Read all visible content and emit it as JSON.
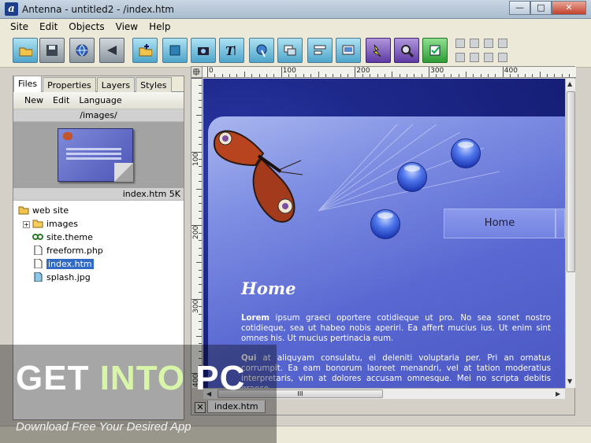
{
  "window": {
    "title": "Antenna - untitled2 - /index.htm",
    "app_icon": "a",
    "min": "—",
    "max": "□",
    "close": "✕"
  },
  "menu": [
    "Site",
    "Edit",
    "Objects",
    "View",
    "Help"
  ],
  "toolbar": {
    "buttons": [
      {
        "name": "open-folder-icon",
        "style": "blue"
      },
      {
        "name": "save-icon",
        "style": "gray"
      },
      {
        "name": "globe-icon",
        "style": "gray"
      },
      {
        "name": "preview-icon",
        "style": "gray"
      },
      {
        "name": "insert-folder-icon",
        "style": "blue"
      },
      {
        "name": "box-icon",
        "style": "blue"
      },
      {
        "name": "camera-icon",
        "style": "blue"
      },
      {
        "name": "text-icon",
        "style": "blue"
      },
      {
        "name": "pointer-icon",
        "style": "blue"
      },
      {
        "name": "images-icon",
        "style": "blue"
      },
      {
        "name": "form-icon",
        "style": "blue"
      },
      {
        "name": "media-icon",
        "style": "blue"
      },
      {
        "name": "effect-icon",
        "style": "purple"
      },
      {
        "name": "zoom-icon",
        "style": "purple"
      },
      {
        "name": "checkbox-icon",
        "style": "green"
      }
    ]
  },
  "left_panel": {
    "tabs": [
      "Files",
      "Properties",
      "Layers",
      "Styles"
    ],
    "active_tab": "Files",
    "subtoolbar": [
      "New",
      "Edit",
      "Language"
    ],
    "path": "/images/",
    "preview_label": "index.htm 5K",
    "tree": [
      {
        "label": "web site",
        "icon": "folder-open-icon",
        "level": 0
      },
      {
        "label": "images",
        "icon": "folder-icon",
        "level": 1,
        "expander": "+"
      },
      {
        "label": "site.theme",
        "icon": "theme-icon",
        "level": 1
      },
      {
        "label": "freeform.php",
        "icon": "file-icon",
        "level": 1
      },
      {
        "label": "index.htm",
        "icon": "file-icon",
        "level": 1,
        "selected": true
      },
      {
        "label": "splash.jpg",
        "icon": "image-file-icon",
        "level": 1
      }
    ]
  },
  "editor": {
    "ruler_top": [
      {
        "label": "0",
        "v": 0
      },
      {
        "label": "100",
        "v": 100
      },
      {
        "label": "200",
        "v": 200
      },
      {
        "label": "300",
        "v": 300
      },
      {
        "label": "400",
        "v": 400
      }
    ],
    "ruler_left": [
      {
        "label": "100",
        "v": 100
      },
      {
        "label": "200",
        "v": 200
      },
      {
        "label": "300",
        "v": 300
      },
      {
        "label": "400",
        "v": 400
      }
    ],
    "page": {
      "nav_button": "Home",
      "heading": "Home",
      "paragraphs": [
        {
          "lead": "Lorem",
          "text": " ipsum graeci oportere cotidieque ut pro. No sea sonet nostro cotidieque, sea ut habeo nobis aperiri. Ea affert mucius ius. Ut enim sint omnes his. Ut mucius pertinacia eum."
        },
        {
          "lead": "Qui",
          "text": " at aliquyam consulatu, ei deleniti voluptaria per. Pri an ornatus corrumpit. Ea eam bonorum laoreet menandri, vel at tation moderatius interpretaris, vim at dolores accusam omnesque. Mei no scripta debitis graeco."
        }
      ]
    },
    "hscroll_grip": "III",
    "doc_tab": "index.htm",
    "close_tab": "✕"
  },
  "watermark": {
    "get": "GET ",
    "into": "INTO",
    "pc": " PC",
    "tagline": "Download Free Your Desired App"
  }
}
